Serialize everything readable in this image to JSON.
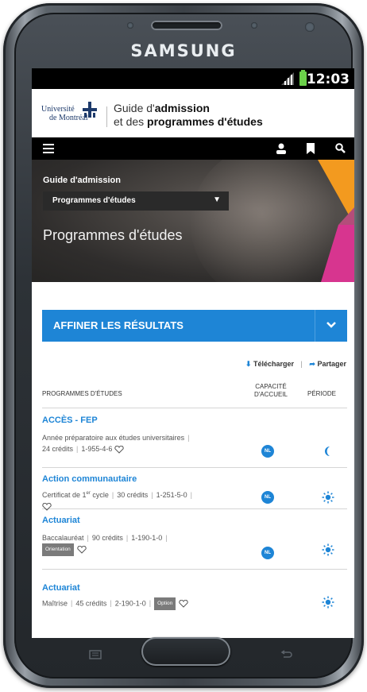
{
  "device": {
    "brand": "SAMSUNG"
  },
  "status_bar": {
    "time": "12:03"
  },
  "header": {
    "logo_line1": "Université",
    "logo_line2": "de Montréal",
    "title_line1_prefix": "Guide d'",
    "title_line1_bold": "admission",
    "title_line2_prefix": "et des ",
    "title_line2_bold": "programmes d'études"
  },
  "hero": {
    "section_label": "Guide d'admission",
    "select_value": "Programmes d'études",
    "title": "Programmes d'études",
    "colors": {
      "orange": "#f39a1f",
      "pink": "#d7358f"
    }
  },
  "refine": {
    "label": "AFFINER LES RÉSULTATS"
  },
  "actions": {
    "download": "Télécharger",
    "share": "Partager"
  },
  "table": {
    "col_programs": "PROGRAMMES D'ÉTUDES",
    "col_capacity_line1": "CAPACITÉ",
    "col_capacity_line2": "D'ACCUEIL",
    "col_period": "PÉRIODE"
  },
  "programs": [
    {
      "title": "ACCÈS - FEP",
      "desc1": "Année préparatoire aux études universitaires",
      "desc2a": "24 crédits",
      "desc2b": "1-955-4-6",
      "badge": "NL",
      "period_icon": "moon-icon"
    },
    {
      "title": "Action communautaire",
      "desc1a": "Certificat de 1",
      "desc1sup": "er",
      "desc1b": " cycle",
      "desc1c": "30 crédits",
      "desc1d": "1-251-5-0",
      "badge": "NL",
      "period_icon": "sun-icon"
    },
    {
      "title": "Actuariat",
      "desc1a": "Baccalauréat",
      "desc1b": "90 crédits",
      "desc1c": "1-190-1-0",
      "tag": "Orientation",
      "badge": "NL",
      "period_icon": "sun-icon"
    },
    {
      "title": "Actuariat",
      "desc1a": "Maîtrise",
      "desc1b": "45 crédits",
      "desc1c": "2-190-1-0",
      "tag": "Option",
      "period_icon": "sun-icon"
    }
  ],
  "colors": {
    "accent": "#1e85d6"
  }
}
